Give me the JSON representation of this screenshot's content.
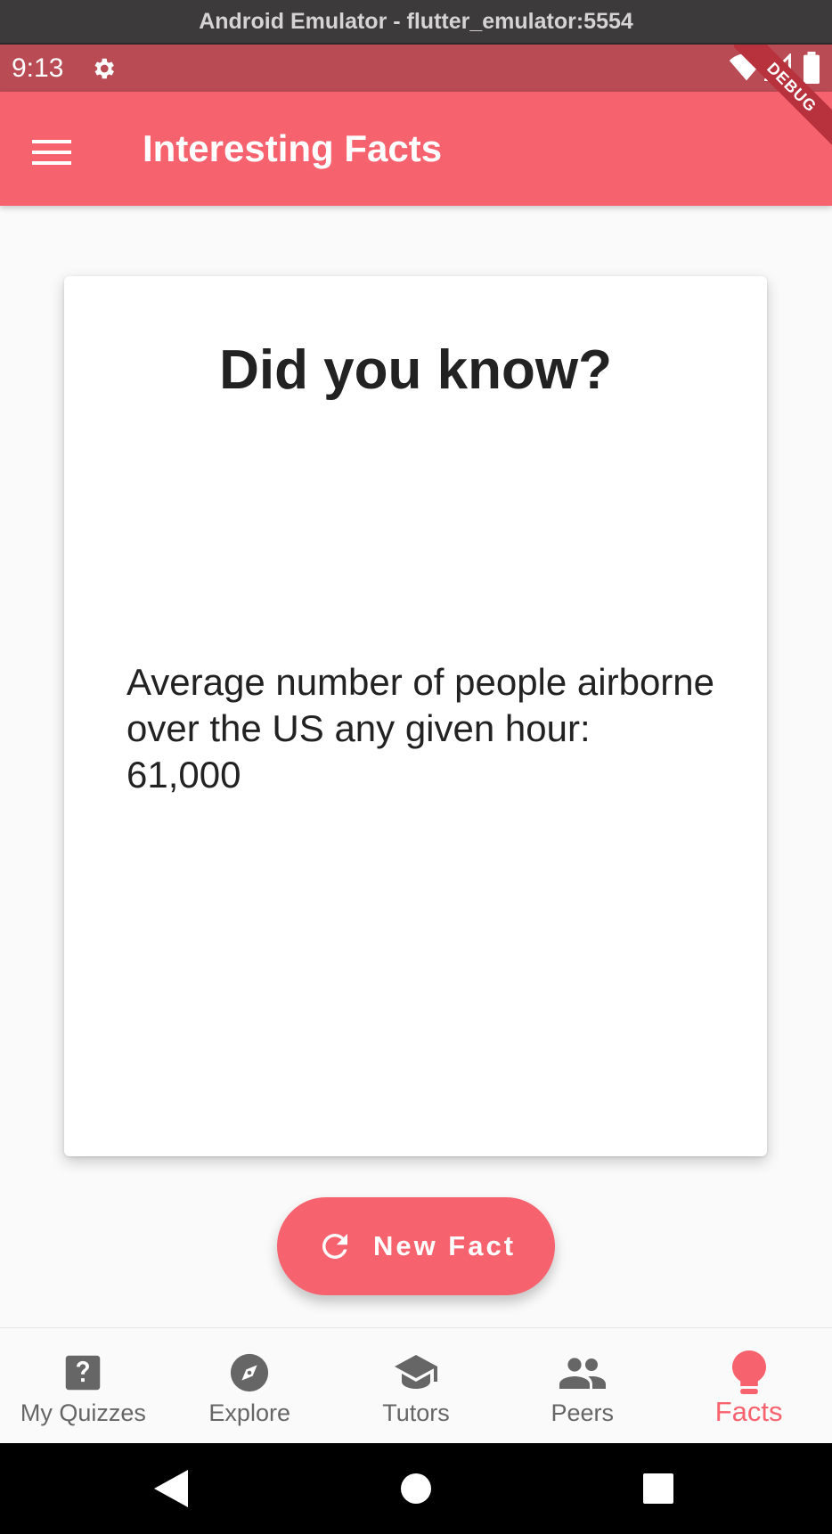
{
  "window": {
    "title": "Android Emulator - flutter_emulator:5554"
  },
  "status_bar": {
    "time": "9:13"
  },
  "debug_banner": "DEBUG",
  "app_bar": {
    "title": "Interesting Facts"
  },
  "card": {
    "heading": "Did you know?",
    "fact": "Average number of people airborne over the US any given hour: 61,000"
  },
  "new_fact_button": {
    "label": "New Fact"
  },
  "bottom_nav": {
    "items": [
      {
        "label": "My Quizzes",
        "icon": "quiz-icon",
        "active": false
      },
      {
        "label": "Explore",
        "icon": "compass-icon",
        "active": false
      },
      {
        "label": "Tutors",
        "icon": "graduation-cap-icon",
        "active": false
      },
      {
        "label": "Peers",
        "icon": "people-icon",
        "active": false
      },
      {
        "label": "Facts",
        "icon": "lightbulb-icon",
        "active": true
      }
    ]
  },
  "colors": {
    "accent": "#f7626f",
    "status_bar": "#b84b54",
    "inactive": "#666666"
  }
}
